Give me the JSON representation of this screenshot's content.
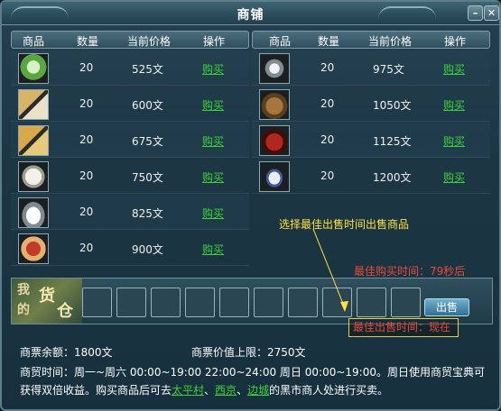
{
  "window": {
    "title": "商铺",
    "minimize_icon": "minimize-icon",
    "close_icon": "close-icon",
    "min_glyph": "–",
    "close_glyph": "✕"
  },
  "columns": {
    "item": "商品",
    "qty": "数量",
    "price": "当前价格",
    "action": "操作"
  },
  "left_items": [
    {
      "icon": "green-vegetable-icon",
      "qty": "20",
      "price": "525文",
      "buy": "购买"
    },
    {
      "icon": "rice-sack-icon",
      "qty": "20",
      "price": "600文",
      "buy": "购买"
    },
    {
      "icon": "grain-sack-icon",
      "qty": "20",
      "price": "675文",
      "buy": "购买"
    },
    {
      "icon": "cotton-icon",
      "qty": "20",
      "price": "750文",
      "buy": "购买"
    },
    {
      "icon": "salt-plate-icon",
      "qty": "20",
      "price": "825文",
      "buy": "购买"
    },
    {
      "icon": "tea-box-icon",
      "qty": "20",
      "price": "900文",
      "buy": "购买"
    }
  ],
  "right_items": [
    {
      "icon": "pearl-string-icon",
      "qty": "20",
      "price": "975文",
      "buy": "购买"
    },
    {
      "icon": "medicine-pouch-icon",
      "qty": "20",
      "price": "1050文",
      "buy": "购买"
    },
    {
      "icon": "wine-jar-icon",
      "qty": "20",
      "price": "1125文",
      "buy": "购买"
    },
    {
      "icon": "porcelain-vase-icon",
      "qty": "20",
      "price": "1200文",
      "buy": "购买"
    }
  ],
  "tip": "选择最佳出售时间出售商品",
  "best_buy_time": "最佳购买时间：79秒后",
  "warehouse": {
    "logo_text": [
      "我",
      "的",
      "货",
      "仓"
    ],
    "slot_count": 10,
    "sell_label": "出售",
    "best_sell_time": "最佳出售时间：现在"
  },
  "footer": {
    "balance": "商票余额：1800文",
    "cap": "商票价值上限：2750文",
    "note_prefix": "商贸时间：周一~周六 00:00~19:00 22:00~24:00 周日 00:00~19:00。周日使用商贸宝典可获得双倍收益。购买商品后可去",
    "town1": "太平村",
    "sep1": "、",
    "town2": "西京",
    "sep2": "、",
    "town3": "边城",
    "note_suffix": "的黑市商人处进行买卖。"
  },
  "colors": {
    "buy_link": "#3bd33b",
    "tip": "#ffe23c",
    "alert": "#e84b3a"
  }
}
